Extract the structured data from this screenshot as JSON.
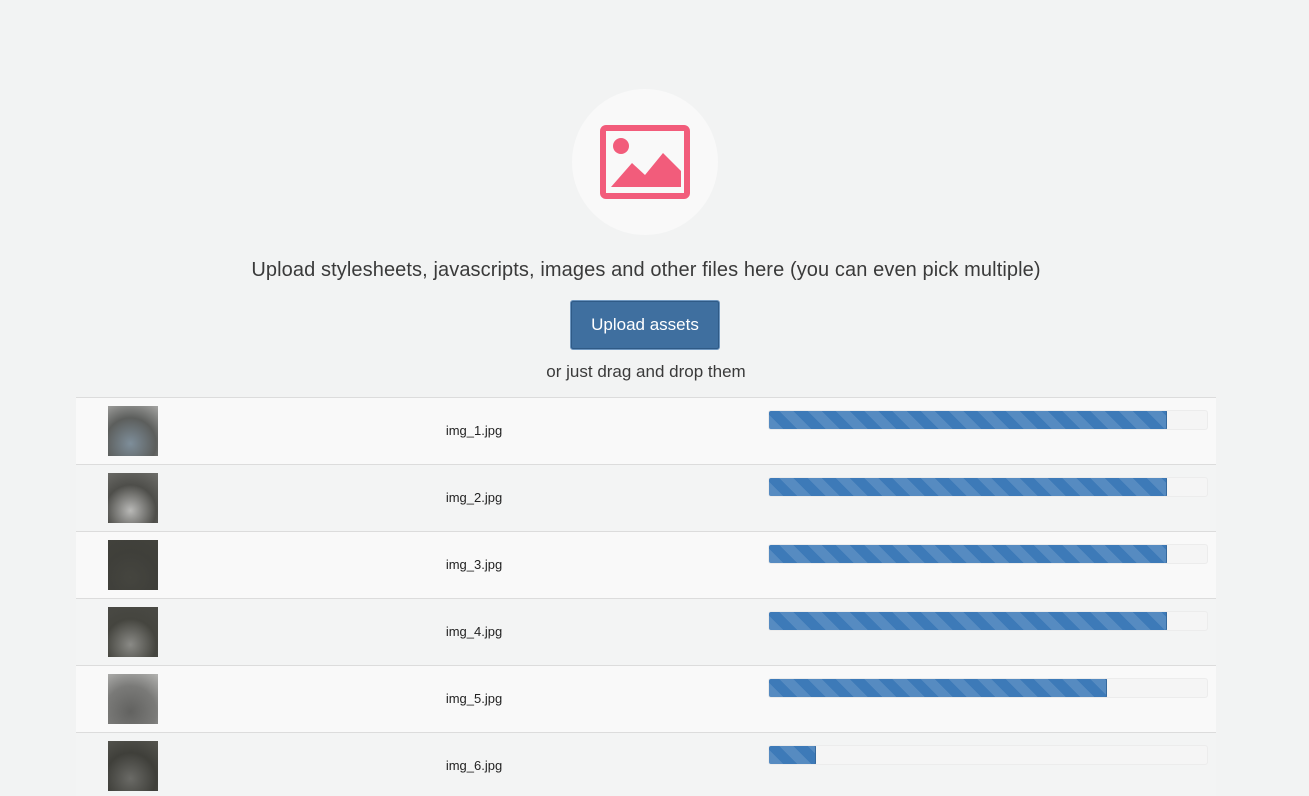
{
  "dropzone": {
    "headline": "Upload stylesheets, javascripts, images and other files here (you can even pick multiple)",
    "upload_button_label": "Upload assets",
    "drag_hint": "or just drag and drop them",
    "icon": "image-icon",
    "icon_color": "#f25c7b",
    "button_color": "#3f6f9f"
  },
  "files": [
    {
      "name": "img_1.jpg",
      "progress": 0.91,
      "thumb_colors": [
        "#a6a6a4",
        "#5c5e5c",
        "#7e8e9a"
      ]
    },
    {
      "name": "img_2.jpg",
      "progress": 0.91,
      "thumb_colors": [
        "#6e6e6a",
        "#4e4e4a",
        "#b9b9b7"
      ]
    },
    {
      "name": "img_3.jpg",
      "progress": 0.91,
      "thumb_colors": [
        "#42423c",
        "#3f3f3a",
        "#45453f"
      ]
    },
    {
      "name": "img_4.jpg",
      "progress": 0.91,
      "thumb_colors": [
        "#4a4a45",
        "#45453f",
        "#8a8a86"
      ]
    },
    {
      "name": "img_5.jpg",
      "progress": 0.775,
      "thumb_colors": [
        "#b3b3b1",
        "#7a7a78",
        "#626260"
      ]
    },
    {
      "name": "img_6.jpg",
      "progress": 0.11,
      "thumb_colors": [
        "#55554f",
        "#3f3f3a",
        "#6a6a66"
      ]
    }
  ],
  "progress_color": "#3d7ab8"
}
